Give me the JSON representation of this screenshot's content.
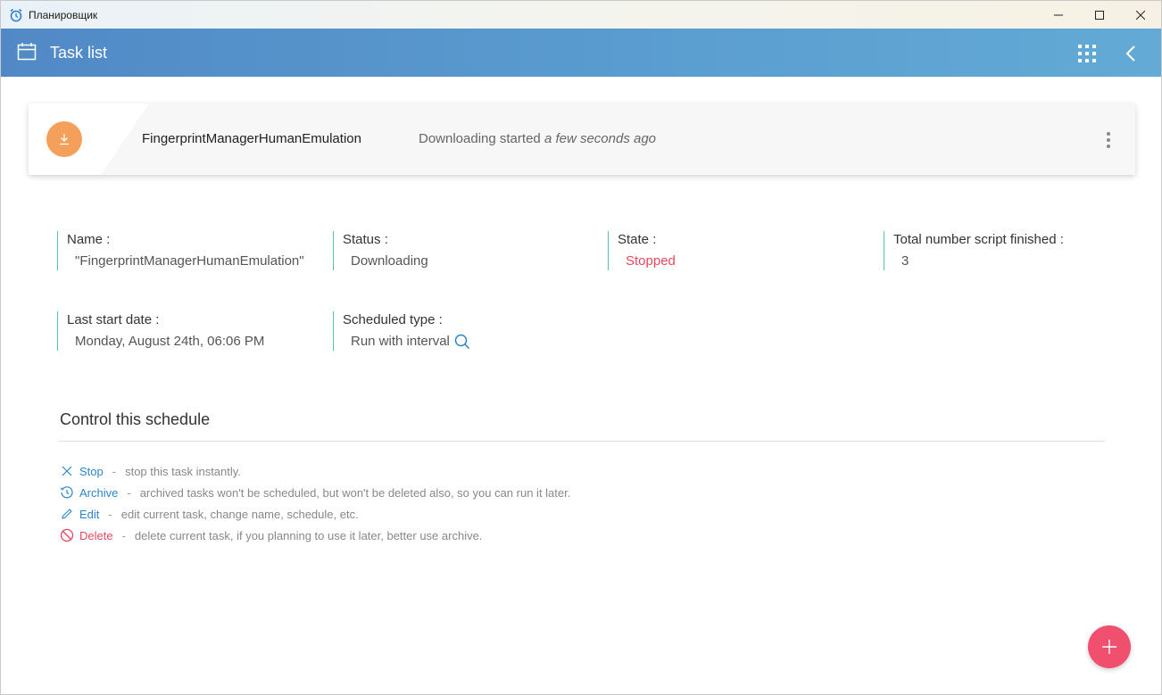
{
  "window": {
    "title": "Планировщик"
  },
  "header": {
    "title": "Task list"
  },
  "task": {
    "name": "FingerprintManagerHumanEmulation",
    "status_prefix": "Downloading started",
    "status_time": "a few seconds ago"
  },
  "fields": {
    "name_label": "Name :",
    "name_value": "\"FingerprintManagerHumanEmulation\"",
    "status_label": "Status :",
    "status_value": "Downloading",
    "state_label": "State :",
    "state_value": "Stopped",
    "total_label": "Total number script finished :",
    "total_value": "3",
    "last_start_label": "Last start date :",
    "last_start_value": "Monday, August 24th, 06:06 PM",
    "scheduled_type_label": "Scheduled type :",
    "scheduled_type_value": "Run with interval"
  },
  "control": {
    "title": "Control this schedule",
    "actions": [
      {
        "label": "Stop",
        "desc": "stop this task instantly.",
        "icon": "close-icon"
      },
      {
        "label": "Archive",
        "desc": "archived tasks won't be scheduled, but won't be deleted also, so you can run it later.",
        "icon": "history-icon"
      },
      {
        "label": "Edit",
        "desc": "edit current task, change name, schedule, etc.",
        "icon": "pencil-icon"
      },
      {
        "label": "Delete",
        "desc": "delete current task, if you planning to use it later, better use archive.",
        "icon": "forbidden-icon"
      }
    ],
    "separator": "-"
  },
  "colors": {
    "accent_blue": "#2b86c9",
    "danger_red": "#e8475f",
    "field_border": "#4fc3b5",
    "task_icon_orange": "#f5a05a",
    "fab_pink": "#f0506e"
  }
}
